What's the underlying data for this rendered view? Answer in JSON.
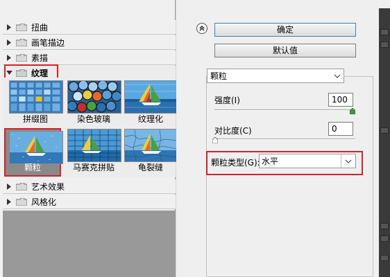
{
  "categories_top": [
    {
      "label": "扭曲"
    },
    {
      "label": "画笔描边"
    },
    {
      "label": "素描"
    }
  ],
  "expanded_category": {
    "label": "纹理"
  },
  "thumbnails": [
    {
      "label": "拼缀图"
    },
    {
      "label": "染色玻璃"
    },
    {
      "label": "纹理化"
    },
    {
      "label": "颗粒",
      "selected": true
    },
    {
      "label": "马赛克拼贴"
    },
    {
      "label": "龟裂缝"
    }
  ],
  "categories_bottom": [
    {
      "label": "艺术效果"
    },
    {
      "label": "风格化"
    }
  ],
  "buttons": {
    "ok": "确定",
    "default": "默认值"
  },
  "filter_select": {
    "value": "颗粒"
  },
  "intensity": {
    "label": "强度(I)",
    "value": "100",
    "level": 1.0
  },
  "contrast": {
    "label": "对比度(C)",
    "value": "0",
    "level": 0.0
  },
  "grain_type": {
    "label": "颗粒类型(G):",
    "value": "水平"
  },
  "colors": {
    "highlight": "#d8202a",
    "background": "#f0f0f0"
  },
  "icons": {
    "collapse": "chevron-up-icon",
    "expand": "triangle-right-icon",
    "expanded": "triangle-down-icon",
    "folder": "folder-icon"
  }
}
